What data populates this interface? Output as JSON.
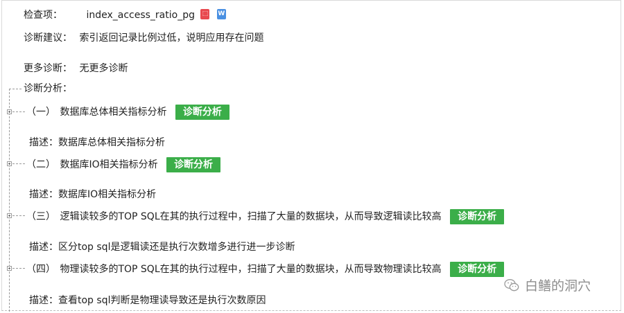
{
  "header": {
    "check_label": "检查项：",
    "check_value": "index_access_ratio_pg",
    "pdf_icon_glyph": "⬚",
    "word_icon_glyph": "W",
    "suggestion_label": "诊断建议：",
    "suggestion_value": "索引返回记录比例过低，说明应用存在问题",
    "more_label": "更多诊断：",
    "more_value": "无更多诊断"
  },
  "analysis": {
    "title": "诊断分析：",
    "button_label": "诊断分析",
    "items": [
      {
        "index": "（一）",
        "title": "数据库总体相关指标分析",
        "desc": "描述：数据库总体相关指标分析"
      },
      {
        "index": "（二）",
        "title": "数据库IO相关指标分析",
        "desc": "描述：数据库IO相关指标分析"
      },
      {
        "index": "（三）",
        "title": "逻辑读较多的TOP SQL在其的执行过程中，扫描了大量的数据块，从而导致逻辑读比较高",
        "desc": "描述：区分top sql是逻辑读还是执行次数增多进行进一步诊断"
      },
      {
        "index": "（四）",
        "title": "物理读较多的TOP SQL在其的执行过程中，扫描了大量的数据块，从而导致物理读比较高",
        "desc": "描述：查看top sql判断是物理读导致还是执行次数原因"
      }
    ]
  },
  "watermark": {
    "text": "白鳝的洞穴",
    "icon": "wechat-icon"
  },
  "colors": {
    "button_green": "#3bae49",
    "pdf_red": "#e8494f",
    "word_blue": "#4a90e2"
  }
}
